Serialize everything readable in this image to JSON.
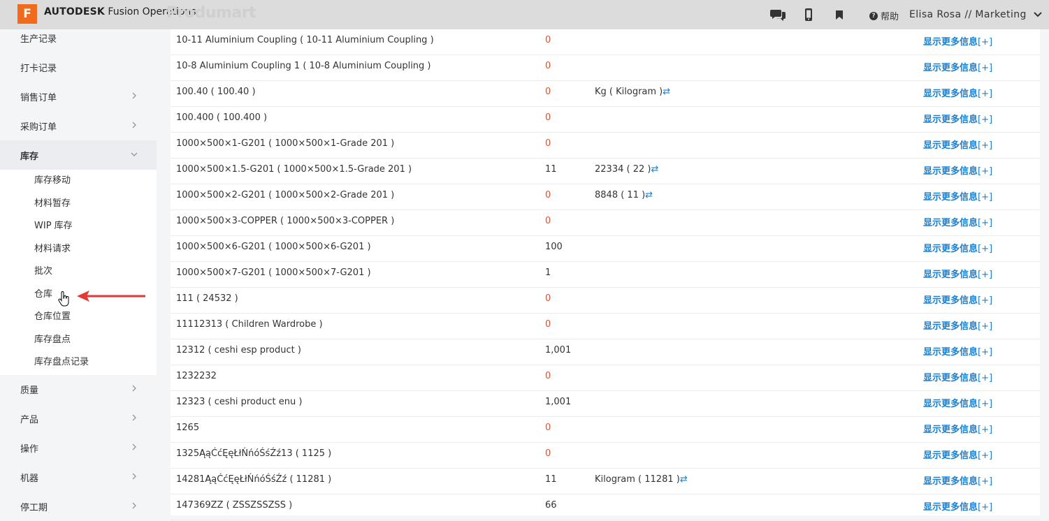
{
  "header": {
    "logo_letter": "F",
    "brand_bold": "AUTODESK",
    "brand_rest": " Fusion Operations",
    "ghost_logo": "Produmart",
    "help_label": "帮助",
    "user_label": "Elisa Rosa // Marketing",
    "icons": [
      "chat-icon",
      "mobile-icon",
      "bookmark-icon",
      "help-icon",
      "chevron-down-icon"
    ]
  },
  "sidebar": {
    "items": [
      {
        "label": "生产记录",
        "chevron": false
      },
      {
        "label": "打卡记录",
        "chevron": false
      },
      {
        "label": "销售订单",
        "chevron": true
      },
      {
        "label": "采购订单",
        "chevron": true
      },
      {
        "label": "库存",
        "chevron": true,
        "open": true
      },
      {
        "label": "质量",
        "chevron": true
      },
      {
        "label": "产品",
        "chevron": true
      },
      {
        "label": "操作",
        "chevron": true
      },
      {
        "label": "机器",
        "chevron": true
      },
      {
        "label": "停工期",
        "chevron": true
      }
    ],
    "sub_items": [
      "库存移动",
      "材料暂存",
      "WIP 库存",
      "材料请求",
      "批次",
      "仓库",
      "仓库位置",
      "库存盘点",
      "库存盘点记录"
    ]
  },
  "table": {
    "more_label": "显示更多信息",
    "more_suffix": "[+]",
    "rows": [
      {
        "name": "10-11 Aluminium Coupling ( 10-11 Aluminium Coupling )",
        "qty": "0",
        "uom": ""
      },
      {
        "name": "10-8 Aluminium Coupling 1 ( 10-8 Aluminium Coupling )",
        "qty": "0",
        "uom": ""
      },
      {
        "name": "100.40 ( 100.40 )",
        "qty": "0",
        "uom": "Kg ( Kilogram )"
      },
      {
        "name": "100.400 ( 100.400 )",
        "qty": "0",
        "uom": ""
      },
      {
        "name": "1000×500×1-G201 ( 1000×500×1-Grade 201 )",
        "qty": "0",
        "uom": ""
      },
      {
        "name": "1000×500×1.5-G201 ( 1000×500×1.5-Grade 201 )",
        "qty": "11",
        "uom": "22334 ( 22 )"
      },
      {
        "name": "1000×500×2-G201 ( 1000×500×2-Grade 201 )",
        "qty": "0",
        "uom": "8848 ( 11 )"
      },
      {
        "name": "1000×500×3-COPPER ( 1000×500×3-COPPER )",
        "qty": "0",
        "uom": ""
      },
      {
        "name": "1000×500×6-G201 ( 1000×500×6-G201 )",
        "qty": "100",
        "uom": ""
      },
      {
        "name": "1000×500×7-G201 ( 1000×500×7-G201 )",
        "qty": "1",
        "uom": ""
      },
      {
        "name": "111 ( 24532 )",
        "qty": "0",
        "uom": ""
      },
      {
        "name": "11112313 ( Children Wardrobe )",
        "qty": "0",
        "uom": ""
      },
      {
        "name": "12312 ( ceshi esp product )",
        "qty": "1,001",
        "uom": ""
      },
      {
        "name": "1232232",
        "qty": "0",
        "uom": ""
      },
      {
        "name": "12323 ( ceshi product enu )",
        "qty": "1,001",
        "uom": ""
      },
      {
        "name": "1265",
        "qty": "0",
        "uom": ""
      },
      {
        "name": "1325ĄąĆćĘęŁłŃńóŚśŹź13 ( 1125 )",
        "qty": "0",
        "uom": ""
      },
      {
        "name": "14281ĄąĆćĘęŁłŃńóŚśŹź ( 11281 )",
        "qty": "11",
        "uom": "Kilogram ( 11281 )"
      },
      {
        "name": "147369ZZ ( ZSSZSSZSS )",
        "qty": "66",
        "uom": ""
      }
    ]
  },
  "colors": {
    "zero_qty": "#e0502a",
    "link": "#1a7fd0",
    "accent": "#f26b1d",
    "annotation_arrow": "#e53935"
  }
}
